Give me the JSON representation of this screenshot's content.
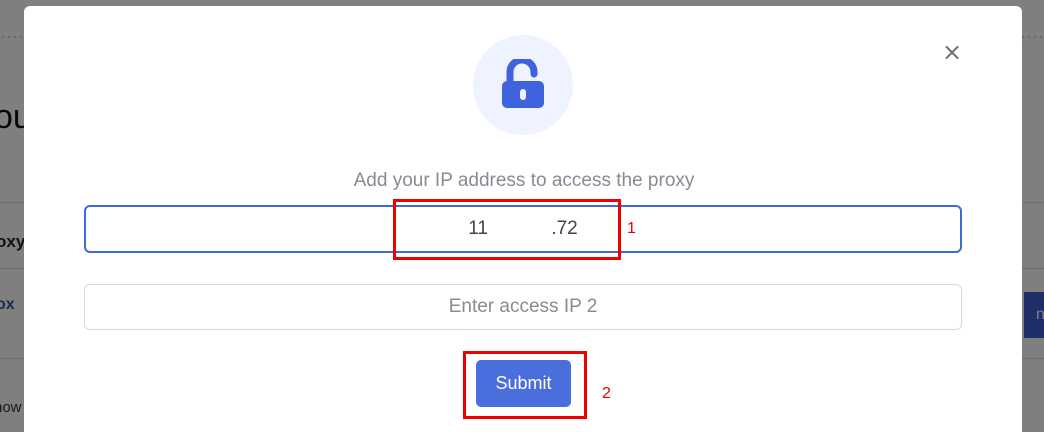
{
  "background": {
    "title_fragment": "ou",
    "proxy_heading_fragment": "oxy",
    "proxy_link_fragment": "ox",
    "row_text_fragment": "now",
    "button_fragment": "ng"
  },
  "modal": {
    "close_label": "×",
    "icon": "unlock-icon",
    "subtitle": "Add your IP address to access the proxy",
    "ip_input_1": {
      "value": "11            .72"
    },
    "ip_input_2": {
      "placeholder": "Enter access IP 2"
    },
    "submit_label": "Submit"
  },
  "annotations": {
    "label_1": "1",
    "label_2": "2"
  },
  "colors": {
    "accent": "#4a6fdc",
    "annotation": "#ee0000",
    "icon_bg": "#eef3ff"
  }
}
